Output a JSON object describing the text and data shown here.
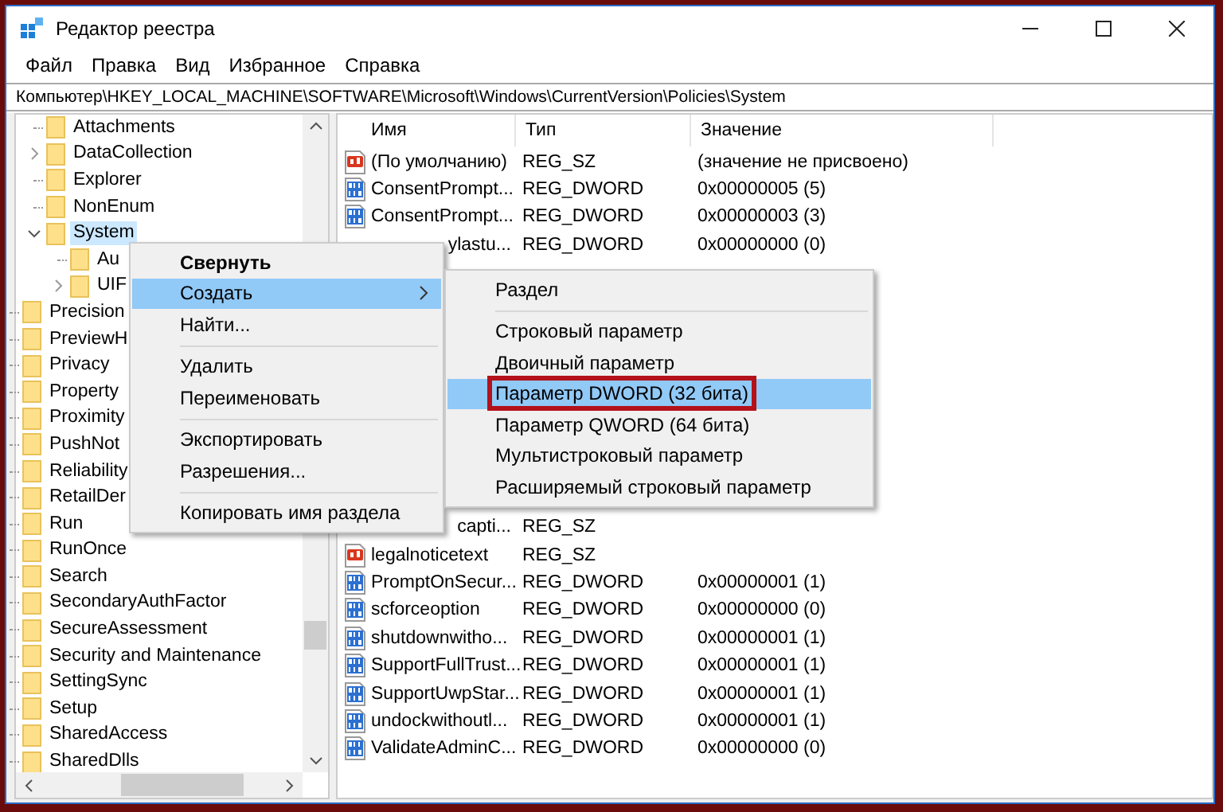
{
  "window": {
    "title": "Редактор реестра"
  },
  "menu": [
    "Файл",
    "Правка",
    "Вид",
    "Избранное",
    "Справка"
  ],
  "address": "Компьютер\\HKEY_LOCAL_MACHINE\\SOFTWARE\\Microsoft\\Windows\\CurrentVersion\\Policies\\System",
  "tree": [
    {
      "children": [
        {
          "label": "Attachments",
          "selected": false
        },
        {
          "label": "DataCollection",
          "selected": false,
          "expanded": false
        },
        {
          "label": "Explorer",
          "selected": false
        },
        {
          "label": "NonEnum",
          "selected": false
        },
        {
          "label": "System",
          "selected": true,
          "expanded": true,
          "children": [
            {
              "label": "Au",
              "selected": false
            },
            {
              "label": "UIF",
              "selected": false,
              "expanded": false
            }
          ]
        }
      ]
    },
    {
      "label": "Precision",
      "selected": false
    },
    {
      "label": "PreviewH",
      "selected": false
    },
    {
      "label": "Privacy",
      "selected": false
    },
    {
      "label": "Property",
      "selected": false
    },
    {
      "label": "Proximity",
      "selected": false
    },
    {
      "label": "PushNot",
      "selected": false
    },
    {
      "label": "Reliability",
      "selected": false
    },
    {
      "label": "RetailDer",
      "selected": false
    },
    {
      "label": "Run",
      "selected": false
    },
    {
      "label": "RunOnce",
      "selected": false
    },
    {
      "label": "Search",
      "selected": false
    },
    {
      "label": "SecondaryAuthFactor",
      "selected": false
    },
    {
      "label": "SecureAssessment",
      "selected": false
    },
    {
      "label": "Security and Maintenance",
      "selected": false
    },
    {
      "label": "SettingSync",
      "selected": false
    },
    {
      "label": "Setup",
      "selected": false
    },
    {
      "label": "SharedAccess",
      "selected": false
    },
    {
      "label": "SharedDlls",
      "selected": false
    }
  ],
  "table": {
    "columns": [
      "Имя",
      "Тип",
      "Значение"
    ],
    "rows": [
      {
        "kind": "string",
        "name": "(По умолчанию)",
        "type": "REG_SZ",
        "value": "(значение не присвоено)"
      },
      {
        "kind": "dword",
        "name": "ConsentPrompt...",
        "type": "REG_DWORD",
        "value": "0x00000005 (5)"
      },
      {
        "kind": "dword",
        "name": "ConsentPrompt...",
        "type": "REG_DWORD",
        "value": "0x00000003 (3)"
      },
      {
        "kind": "clipped",
        "name": "ylastu...",
        "type": "REG_DWORD",
        "value": "0x00000000 (0)"
      }
    ],
    "rows_below_menu": [
      {
        "kind": "clipped",
        "name": "capti...",
        "type": "REG_SZ"
      },
      {
        "kind": "string",
        "name": "legalnoticetext",
        "type": "REG_SZ"
      },
      {
        "kind": "dword",
        "name": "PromptOnSecur...",
        "type": "REG_DWORD",
        "value": "0x00000001 (1)"
      },
      {
        "kind": "dword",
        "name": "scforceoption",
        "type": "REG_DWORD",
        "value": "0x00000000 (0)"
      },
      {
        "kind": "dword",
        "name": "shutdownwitho...",
        "type": "REG_DWORD",
        "value": "0x00000001 (1)"
      },
      {
        "kind": "dword",
        "name": "SupportFullTrust...",
        "type": "REG_DWORD",
        "value": "0x00000001 (1)"
      },
      {
        "kind": "dword",
        "name": "SupportUwpStar...",
        "type": "REG_DWORD",
        "value": "0x00000001 (1)"
      },
      {
        "kind": "dword",
        "name": "undockwithoutl...",
        "type": "REG_DWORD",
        "value": "0x00000001 (1)"
      },
      {
        "kind": "dword",
        "name": "ValidateAdminC...",
        "type": "REG_DWORD",
        "value": "0x00000000 (0)"
      }
    ]
  },
  "context_menu": [
    {
      "kind": "item",
      "label": "Свернуть",
      "default": true,
      "selected": false
    },
    {
      "kind": "item",
      "label": "Создать",
      "submenu": true,
      "selected": true
    },
    {
      "kind": "item",
      "label": "Найти...",
      "selected": false
    },
    {
      "kind": "separator"
    },
    {
      "kind": "item",
      "label": "Удалить",
      "selected": false
    },
    {
      "kind": "item",
      "label": "Переименовать",
      "selected": false
    },
    {
      "kind": "separator"
    },
    {
      "kind": "item",
      "label": "Экспортировать",
      "selected": false
    },
    {
      "kind": "item",
      "label": "Разрешения...",
      "selected": false
    },
    {
      "kind": "separator"
    },
    {
      "kind": "item",
      "label": "Копировать имя раздела",
      "selected": false
    }
  ],
  "submenu": [
    {
      "kind": "item",
      "label": "Раздел",
      "selected": false
    },
    {
      "kind": "separator"
    },
    {
      "kind": "item",
      "label": "Строковый параметр",
      "selected": false
    },
    {
      "kind": "item",
      "label": "Двоичный параметр",
      "selected": false
    },
    {
      "kind": "item",
      "label": "Параметр DWORD (32 бита)",
      "selected": true,
      "annotated": true
    },
    {
      "kind": "item",
      "label": "Параметр QWORD (64 бита)",
      "selected": false
    },
    {
      "kind": "item",
      "label": "Мультистроковый параметр",
      "selected": false
    },
    {
      "kind": "item",
      "label": "Расширяемый строковый параметр",
      "selected": false
    }
  ]
}
